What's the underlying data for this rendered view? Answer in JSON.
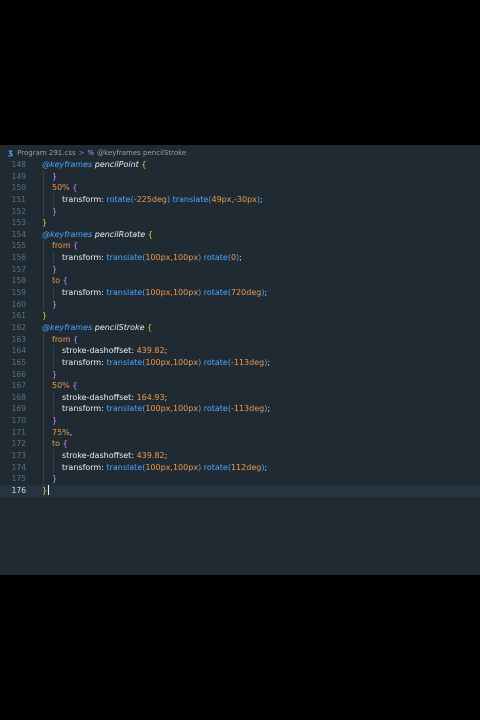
{
  "breadcrumb": {
    "file": "Program 291.css",
    "separator": ">",
    "symbol": "@keyframes pencilStroke"
  },
  "lines": [
    {
      "n": "148",
      "indent": 0,
      "tokens": [
        [
          "kw",
          "@keyframes "
        ],
        [
          "name",
          "pencilPoint "
        ],
        [
          "brace",
          "{"
        ]
      ]
    },
    {
      "n": "149",
      "indent": 1,
      "tokens": [
        [
          "brace2",
          "}"
        ]
      ]
    },
    {
      "n": "150",
      "indent": 1,
      "tokens": [
        [
          "sel",
          "50% "
        ],
        [
          "brace2",
          "{"
        ]
      ]
    },
    {
      "n": "151",
      "indent": 2,
      "tokens": [
        [
          "prop",
          "transform: "
        ],
        [
          "fn",
          "rotate("
        ],
        [
          "num",
          "-225deg"
        ],
        [
          "fn",
          ")"
        ],
        [
          "fn",
          " translate("
        ],
        [
          "num",
          "49px,-30px"
        ],
        [
          "fn",
          ")"
        ],
        [
          "punct",
          ";"
        ]
      ]
    },
    {
      "n": "152",
      "indent": 1,
      "tokens": [
        [
          "brace2",
          "}"
        ]
      ]
    },
    {
      "n": "153",
      "indent": 0,
      "tokens": [
        [
          "brace",
          "}"
        ]
      ]
    },
    {
      "n": "154",
      "indent": 0,
      "tokens": [
        [
          "kw",
          "@keyframes "
        ],
        [
          "name",
          "pencilRotate "
        ],
        [
          "brace",
          "{"
        ]
      ]
    },
    {
      "n": "155",
      "indent": 1,
      "tokens": [
        [
          "sel",
          "from "
        ],
        [
          "brace2",
          "{"
        ]
      ]
    },
    {
      "n": "156",
      "indent": 2,
      "tokens": [
        [
          "prop",
          "transform: "
        ],
        [
          "fn",
          "translate("
        ],
        [
          "num",
          "100px,100px"
        ],
        [
          "fn",
          ")"
        ],
        [
          "fn",
          " rotate("
        ],
        [
          "num",
          "0"
        ],
        [
          "fn",
          ")"
        ],
        [
          "punct",
          ";"
        ]
      ]
    },
    {
      "n": "157",
      "indent": 1,
      "tokens": [
        [
          "brace2",
          "}"
        ]
      ]
    },
    {
      "n": "158",
      "indent": 1,
      "tokens": [
        [
          "sel",
          "to "
        ],
        [
          "brace2",
          "{"
        ]
      ]
    },
    {
      "n": "159",
      "indent": 2,
      "tokens": [
        [
          "prop",
          "transform: "
        ],
        [
          "fn",
          "translate("
        ],
        [
          "num",
          "100px,100px"
        ],
        [
          "fn",
          ")"
        ],
        [
          "fn",
          " rotate("
        ],
        [
          "num",
          "720deg"
        ],
        [
          "fn",
          ")"
        ],
        [
          "punct",
          ";"
        ]
      ]
    },
    {
      "n": "160",
      "indent": 1,
      "tokens": [
        [
          "brace2",
          "}"
        ]
      ]
    },
    {
      "n": "161",
      "indent": 0,
      "tokens": [
        [
          "brace",
          "}"
        ]
      ]
    },
    {
      "n": "162",
      "indent": 0,
      "tokens": [
        [
          "kw",
          "@keyframes "
        ],
        [
          "name",
          "pencilStroke "
        ],
        [
          "brace",
          "{"
        ]
      ]
    },
    {
      "n": "163",
      "indent": 1,
      "tokens": [
        [
          "sel",
          "from "
        ],
        [
          "brace2",
          "{"
        ]
      ]
    },
    {
      "n": "164",
      "indent": 2,
      "tokens": [
        [
          "prop",
          "stroke-dashoffset: "
        ],
        [
          "num",
          "439.82"
        ],
        [
          "punct",
          ";"
        ]
      ]
    },
    {
      "n": "165",
      "indent": 2,
      "tokens": [
        [
          "prop",
          "transform: "
        ],
        [
          "fn",
          "translate("
        ],
        [
          "num",
          "100px,100px"
        ],
        [
          "fn",
          ")"
        ],
        [
          "fn",
          " rotate("
        ],
        [
          "num",
          "-113deg"
        ],
        [
          "fn",
          ")"
        ],
        [
          "punct",
          ";"
        ]
      ]
    },
    {
      "n": "166",
      "indent": 1,
      "tokens": [
        [
          "brace2",
          "}"
        ]
      ]
    },
    {
      "n": "167",
      "indent": 1,
      "tokens": [
        [
          "sel",
          "50% "
        ],
        [
          "brace2",
          "{"
        ]
      ]
    },
    {
      "n": "168",
      "indent": 2,
      "tokens": [
        [
          "prop",
          "stroke-dashoffset: "
        ],
        [
          "num",
          "164.93"
        ],
        [
          "punct",
          ";"
        ]
      ]
    },
    {
      "n": "169",
      "indent": 2,
      "tokens": [
        [
          "prop",
          "transform: "
        ],
        [
          "fn",
          "translate("
        ],
        [
          "num",
          "100px,100px"
        ],
        [
          "fn",
          ")"
        ],
        [
          "fn",
          " rotate("
        ],
        [
          "num",
          "-113deg"
        ],
        [
          "fn",
          ")"
        ],
        [
          "punct",
          ";"
        ]
      ]
    },
    {
      "n": "170",
      "indent": 1,
      "tokens": [
        [
          "brace2",
          "}"
        ]
      ]
    },
    {
      "n": "171",
      "indent": 1,
      "tokens": [
        [
          "sel",
          "75%"
        ],
        [
          "punct",
          ","
        ]
      ]
    },
    {
      "n": "172",
      "indent": 1,
      "tokens": [
        [
          "sel",
          "to "
        ],
        [
          "brace2",
          "{"
        ]
      ]
    },
    {
      "n": "173",
      "indent": 2,
      "tokens": [
        [
          "prop",
          "stroke-dashoffset: "
        ],
        [
          "num",
          "439.82"
        ],
        [
          "punct",
          ";"
        ]
      ]
    },
    {
      "n": "174",
      "indent": 2,
      "tokens": [
        [
          "prop",
          "transform: "
        ],
        [
          "fn",
          "translate("
        ],
        [
          "num",
          "100px,100px"
        ],
        [
          "fn",
          ")"
        ],
        [
          "fn",
          " rotate("
        ],
        [
          "num",
          "112deg"
        ],
        [
          "fn",
          ")"
        ],
        [
          "punct",
          ";"
        ]
      ]
    },
    {
      "n": "175",
      "indent": 1,
      "tokens": [
        [
          "brace2",
          "}"
        ]
      ]
    },
    {
      "n": "176",
      "indent": 0,
      "tokens": [
        [
          "brace",
          "}"
        ]
      ],
      "current": true
    }
  ]
}
